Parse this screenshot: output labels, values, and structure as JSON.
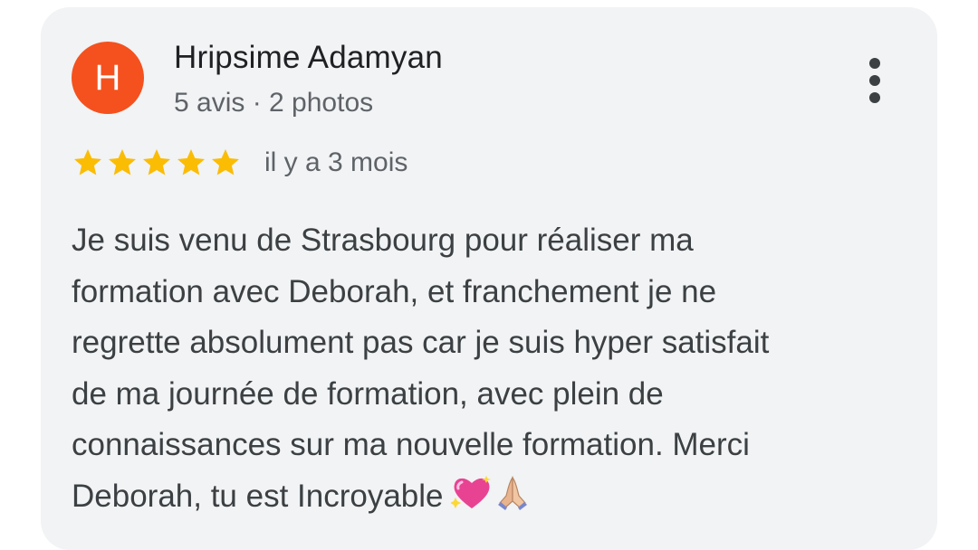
{
  "review": {
    "avatar_initial": "H",
    "author_name": "Hripsime Adamyan",
    "author_meta": "5 avis · 2 photos",
    "rating": 5,
    "rating_max": 5,
    "time_ago": "il y a 3 mois",
    "text_lines": [
      "Je suis venu de Strasbourg pour réaliser ma",
      "formation avec Deborah, et franchement je ne",
      "regrette absolument pas car je suis hyper satisfait",
      "de ma journée de formation, avec plein de",
      "connaissances sur ma nouvelle formation. Merci",
      "Deborah, tu est Incroyable"
    ],
    "emojis": [
      "sparkling-heart-icon",
      "folded-hands-icon"
    ]
  },
  "colors": {
    "avatar_bg": "#f4511e",
    "star": "#fbbc04",
    "card_bg": "#f1f3f4",
    "text_primary": "#202124",
    "text_secondary": "#5f6368"
  }
}
